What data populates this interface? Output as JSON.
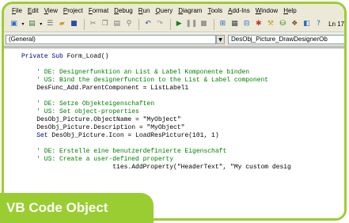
{
  "menu": [
    "File",
    "Edit",
    "View",
    "Project",
    "Format",
    "Debug",
    "Run",
    "Query",
    "Diagram",
    "Tools",
    "Add-Ins",
    "Window",
    "Help"
  ],
  "toolbar": {
    "line_indicator": "Ln 17"
  },
  "selectors": {
    "object": "(General)",
    "procedure": "DesObj_Picture_DrawDesignerOb"
  },
  "code_lines": [
    {
      "kind": "kw",
      "text": "Private Sub Form_Load()"
    },
    {
      "kind": "blank",
      "text": ""
    },
    {
      "kind": "cm",
      "text": "    ' DE: Designerfunktion an List & Label Komponente binden"
    },
    {
      "kind": "cm",
      "text": "    ' US: Bind the designerfunction to the List & Label component"
    },
    {
      "kind": "plain",
      "text": "    DesFunc_Add.ParentComponent = ListLabel1"
    },
    {
      "kind": "blank",
      "text": ""
    },
    {
      "kind": "cm",
      "text": "    ' DE: Setze Objekteigenschaften"
    },
    {
      "kind": "cm",
      "text": "    ' US: Set object-properties"
    },
    {
      "kind": "plain",
      "text": "    DesObj_Picture.ObjectName = \"MyObject\""
    },
    {
      "kind": "plain",
      "text": "    DesObj_Picture.Description = \"MyObject\""
    },
    {
      "kind": "kw",
      "text": "    Set DesObj_Picture.Icon = LoadResPicture(101, 1)"
    },
    {
      "kind": "blank",
      "text": ""
    },
    {
      "kind": "cm",
      "text": "    ' DE: Erstelle eine benutzerdefinierte Eigenschaft"
    },
    {
      "kind": "cm",
      "text": "    ' US: Create a user-defined property"
    },
    {
      "kind": "plain",
      "text": "                        ties.AddProperty(\"HeaderText\", \"My custom desig"
    }
  ],
  "overlay_label": "VB Code Object",
  "colors": {
    "frame": "#9acd32",
    "keyword": "#00008b",
    "comment": "#008000"
  }
}
